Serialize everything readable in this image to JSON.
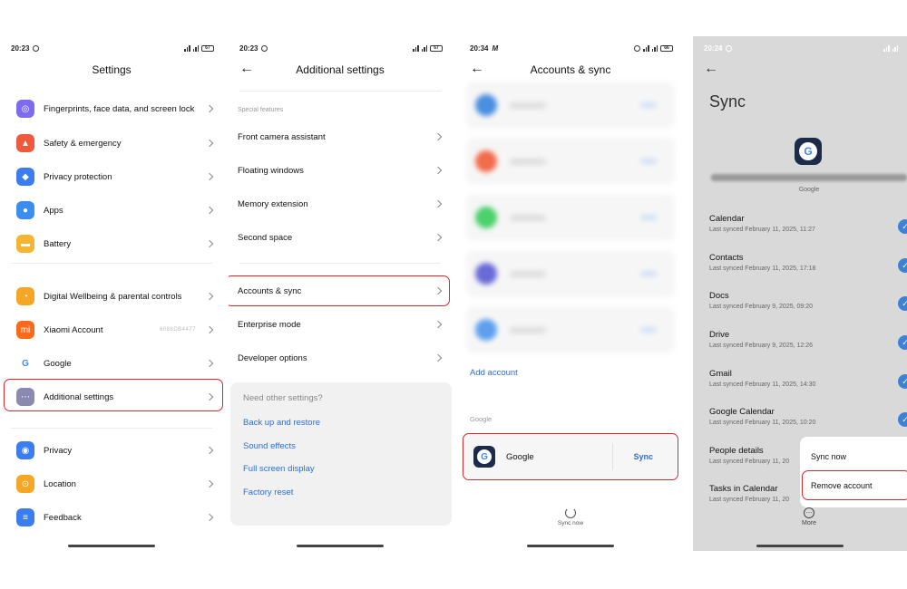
{
  "settings": {
    "status_time": "20:23",
    "battery": "67",
    "title": "Settings",
    "items": [
      {
        "label": "Fingerprints, face data, and screen lock",
        "icon": "fingerprint-icon",
        "color": "#7b6cf0"
      },
      {
        "label": "Safety & emergency",
        "icon": "emergency-icon",
        "color": "#f05a3c"
      },
      {
        "label": "Privacy protection",
        "icon": "privacy-shield-icon",
        "color": "#3b7df0"
      },
      {
        "label": "Apps",
        "icon": "apps-icon",
        "color": "#3b8df0"
      },
      {
        "label": "Battery",
        "icon": "battery-icon",
        "color": "#f5b530"
      },
      {
        "label": "Digital Wellbeing & parental controls",
        "icon": "wellbeing-icon",
        "color": "#f5a623"
      },
      {
        "label": "Xiaomi Account",
        "icon": "xiaomi-icon",
        "color": "#ff6a1a",
        "extra": "6088DB4477"
      },
      {
        "label": "Google",
        "icon": "google-icon",
        "color": "#ffffff"
      },
      {
        "label": "Additional settings",
        "icon": "more-dots-icon",
        "color": "#8a8ab0"
      },
      {
        "label": "Privacy",
        "icon": "eye-icon",
        "color": "#3b7df0"
      },
      {
        "label": "Location",
        "icon": "location-icon",
        "color": "#f5a623"
      },
      {
        "label": "Feedback",
        "icon": "feedback-icon",
        "color": "#3b7df0"
      }
    ]
  },
  "additional": {
    "status_time": "20:23",
    "battery": "67",
    "title": "Additional settings",
    "section": "Special features",
    "items": [
      "Front camera assistant",
      "Floating windows",
      "Memory extension",
      "Second space",
      "Accounts & sync",
      "Enterprise mode",
      "Developer options"
    ],
    "card": {
      "question": "Need other settings?",
      "links": [
        "Back up and restore",
        "Sound effects",
        "Full screen display",
        "Factory reset"
      ]
    }
  },
  "accounts": {
    "status_time": "20:34",
    "status_icon": "M",
    "battery": "66",
    "title": "Accounts & sync",
    "add_account": "Add account",
    "section": "Google",
    "google_label": "Google",
    "sync_label": "Sync",
    "sync_now": "Sync now",
    "blurred_colors": [
      "#4a8fe0",
      "#f26b4a",
      "#4cd26b",
      "#6a6ad8",
      "#5ea0ee"
    ]
  },
  "sync": {
    "status_time": "20:24",
    "title": "Sync",
    "account_type": "Google",
    "items": [
      {
        "name": "Calendar",
        "date": "Last synced February 11, 2025, 11:27"
      },
      {
        "name": "Contacts",
        "date": "Last synced February 11, 2025, 17:18"
      },
      {
        "name": "Docs",
        "date": "Last synced February 9, 2025, 09:20"
      },
      {
        "name": "Drive",
        "date": "Last synced February 9, 2025, 12:26"
      },
      {
        "name": "Gmail",
        "date": "Last synced February 11, 2025, 14:30"
      },
      {
        "name": "Google Calendar",
        "date": "Last synced February 11, 2025, 10:20"
      },
      {
        "name": "People details",
        "date": "Last synced February 11, 20"
      },
      {
        "name": "Tasks in Calendar",
        "date": "Last synced February 11, 20"
      }
    ],
    "menu": {
      "sync_now": "Sync now",
      "remove": "Remove account"
    },
    "more_label": "More"
  }
}
